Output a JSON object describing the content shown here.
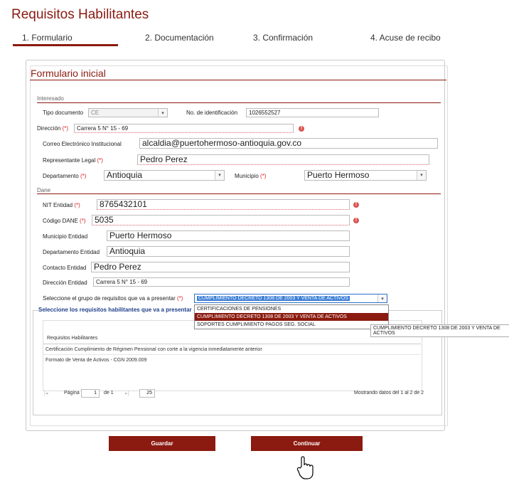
{
  "page": {
    "title": "Requisitos Habilitantes"
  },
  "steps": [
    "1. Formulario",
    "2. Documentación",
    "3. Confirmación",
    "4. Acuse de recibo"
  ],
  "form": {
    "title": "Formulario inicial",
    "section_interesado": "Interesado",
    "tipo_documento_label": "Tipo documento",
    "tipo_documento_value": "CE",
    "no_identificacion_label": "No. de identificación",
    "no_identificacion_value": "1026552527",
    "direccion_label": "Dirección",
    "direccion_value": "Carrera 5 N° 15 - 69",
    "correo_label": "Correo Electrónico Institucional",
    "correo_value": "alcaldia@puertohermoso-antioquia.gov.co",
    "representante_label": "Representante Legal",
    "representante_value": "Pedro Perez",
    "departamento_label": "Departamento",
    "departamento_value": "Antioquia",
    "municipio_label": "Municipio",
    "municipio_value": "Puerto Hermoso",
    "section_dane": "Dane",
    "nit_label": "NIT Entidad",
    "nit_value": "8765432101",
    "codigo_dane_label": "Código DANE",
    "codigo_dane_value": "5035",
    "municipio_entidad_label": "Municipio Entidad",
    "municipio_entidad_value": "Puerto Hermoso",
    "departamento_entidad_label": "Departamento Entidad",
    "departamento_entidad_value": "Antioquia",
    "contacto_label": "Contacto Entidad",
    "contacto_value": "Pedro Perez",
    "direccion_entidad_label": "Dirección Entidad",
    "direccion_entidad_value": "Carrera 5 N° 15 - 69",
    "grupo_label": "Seleccione el grupo de requisitos que va a presentar",
    "grupo_value": "CUMPLIMIENTO DECRETO 1308 DE 2003 Y VENTA DE ACTIVOS",
    "required_mark": "(*)",
    "warn_symbol": "!",
    "arrow_symbol": "▾"
  },
  "dropdown": {
    "options": [
      "CERTIFICACIONES DE PENSIONES",
      "CUMPLIMIENTO DECRETO 1308 DE 2003 Y VENTA DE ACTIVOS",
      "SOPORTES CUMPLIMIENTO PAGOS SEG. SOCIAL"
    ],
    "tooltip": "CUMPLIMIENTO DECRETO 1308 DE 2003 Y VENTA DE ACTIVOS"
  },
  "requisitos": {
    "legend": "Seleccione los requisitos habilitantes que va a presentar",
    "header": "Requisitos Habilitantes",
    "rows": [
      "Certificación Cumplimiento de Régimen Pensional con corte a la vigencia inmediatamente anterior",
      "Formato de Venta de Activos - CGN 2009.009"
    ],
    "pager": {
      "page_label": "Página",
      "page": "1",
      "of_label": "de 1",
      "page_size": "25",
      "summary": "Mostrando datos del 1 al 2 de 2"
    }
  },
  "buttons": {
    "guardar": "Guardar",
    "continuar": "Continuar"
  },
  "colors": {
    "accent": "#8b1a10"
  }
}
